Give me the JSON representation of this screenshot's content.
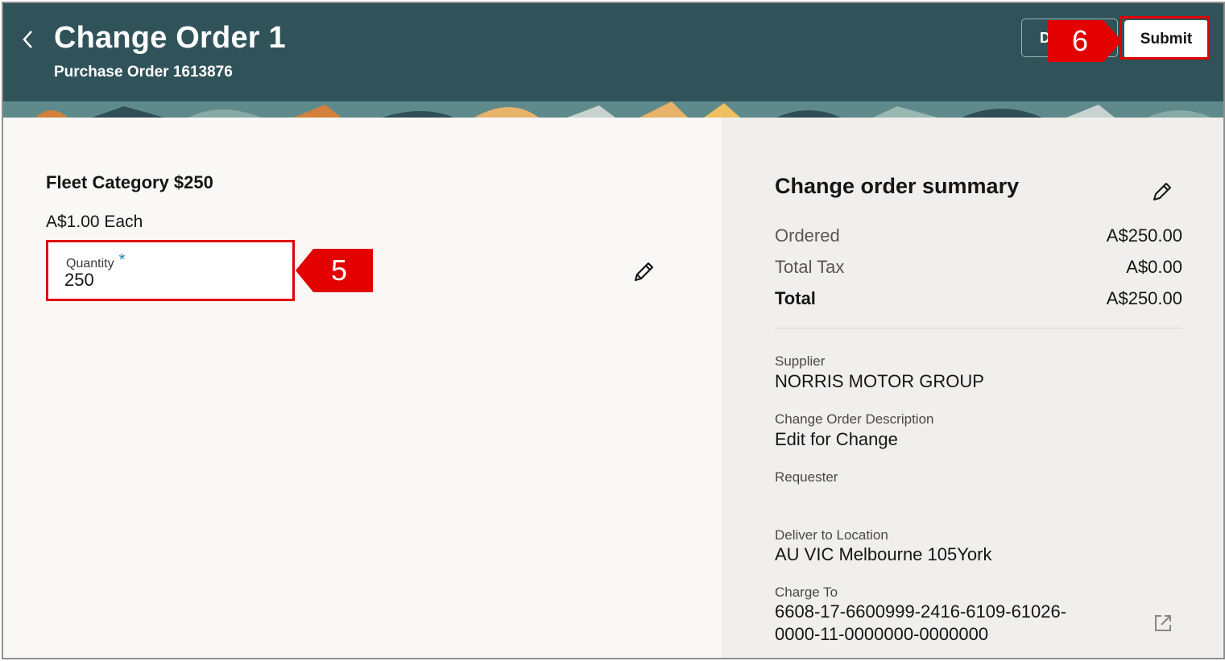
{
  "header": {
    "title": "Change Order 1",
    "subtitle": "Purchase Order 1613876",
    "draft_label": "D",
    "submit_label": "Submit"
  },
  "callouts": {
    "submit_step": "6",
    "quantity_step": "5"
  },
  "item": {
    "title": "Fleet Category $250",
    "unit_price": "A$1.00 Each",
    "quantity_label": "Quantity",
    "quantity_required": "*",
    "quantity_value": "250"
  },
  "summary": {
    "title": "Change order summary",
    "ordered_label": "Ordered",
    "ordered_value": "A$250.00",
    "tax_label": "Total Tax",
    "tax_value": "A$0.00",
    "total_label": "Total",
    "total_value": "A$250.00",
    "supplier_label": "Supplier",
    "supplier_value": "NORRIS MOTOR GROUP",
    "description_label": "Change Order Description",
    "description_value": "Edit for Change",
    "requester_label": "Requester",
    "location_label": "Deliver to Location",
    "location_value": "AU VIC Melbourne 105York",
    "charge_label": "Charge To",
    "charge_value_line1": "6608-17-6600999-2416-6109-61026-",
    "charge_value_line2": "0000-11-0000000-0000000"
  },
  "icons": {
    "back": "chevron-left-icon",
    "edit": "pencil-icon",
    "external": "external-link-icon"
  },
  "colors": {
    "header_bg": "#30535a",
    "highlight": "#e00000",
    "right_panel_bg": "#f1efed"
  }
}
